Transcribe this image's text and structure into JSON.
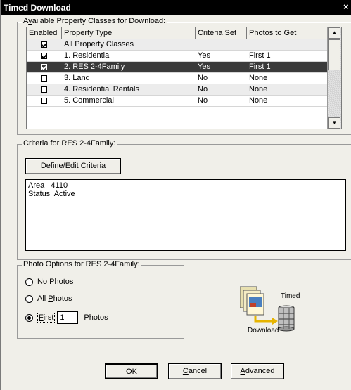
{
  "window": {
    "title": "Timed Download",
    "close_glyph": "×"
  },
  "available_group": {
    "legend_prefix": "A",
    "legend_ul": "v",
    "legend_rest": "ailable Property Classes for Download:",
    "columns": [
      "Enabled",
      "Property Type",
      "Criteria Set",
      "Photos to Get"
    ],
    "rows": [
      {
        "enabled": true,
        "type": "All Property Classes",
        "criteria": "",
        "photos": "",
        "selected": false
      },
      {
        "enabled": true,
        "type": "1. Residential",
        "criteria": "Yes",
        "photos": "First 1",
        "selected": false
      },
      {
        "enabled": true,
        "type": "2. RES 2-4Family",
        "criteria": "Yes",
        "photos": "First 1",
        "selected": true
      },
      {
        "enabled": false,
        "type": "3. Land",
        "criteria": "No",
        "photos": "None",
        "selected": false
      },
      {
        "enabled": false,
        "type": "4. Residential Rentals",
        "criteria": "No",
        "photos": "None",
        "selected": false
      },
      {
        "enabled": false,
        "type": "5. Commercial",
        "criteria": "No",
        "photos": "None",
        "selected": false
      }
    ],
    "scroll_up_icon": "triangle-up-icon",
    "scroll_down_icon": "triangle-down-icon"
  },
  "criteria_group": {
    "legend": "Criteria for RES 2-4Family:",
    "define_prefix": "Define/",
    "define_ul": "E",
    "define_rest": "dit Criteria",
    "criteria_text": "Area   4110\nStatus  Active"
  },
  "photo_group": {
    "legend": "Photo Options for RES 2-4Family:",
    "no_photos_ul": "N",
    "no_photos_rest": "o Photos",
    "all_photos_prefix": "All ",
    "all_photos_ul": "P",
    "all_photos_rest": "hotos",
    "first_ul": "F",
    "first_rest": "irst",
    "first_count": "1",
    "photos_suffix": "Photos",
    "selected": "first"
  },
  "illustration": {
    "label_timed": "Timed",
    "label_download": "Download"
  },
  "buttons": {
    "ok_ul": "O",
    "ok_rest": "K",
    "cancel_ul": "C",
    "cancel_rest": "ancel",
    "advanced_ul": "A",
    "advanced_rest": "dvanced"
  }
}
